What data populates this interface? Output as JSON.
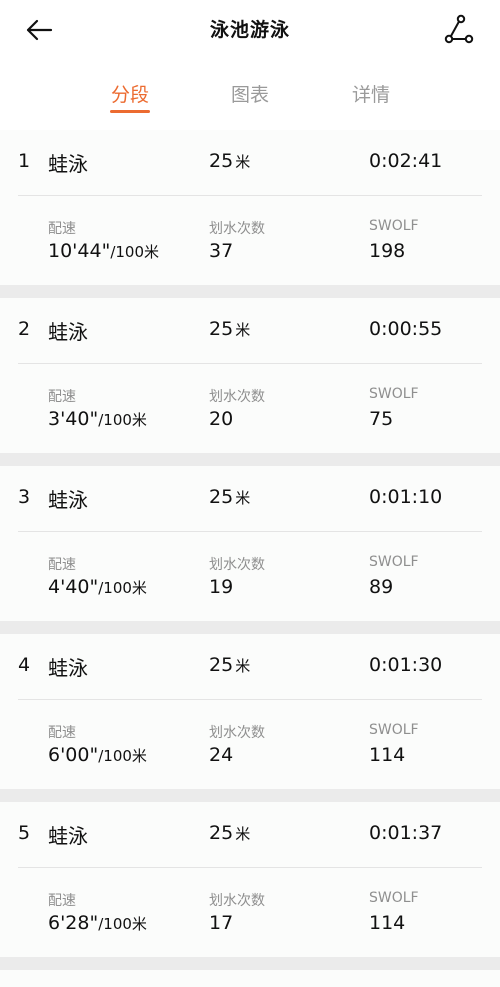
{
  "header": {
    "title": "泳池游泳",
    "back_icon": "arrow-left-icon",
    "route_icon": "route-icon"
  },
  "tabs": [
    {
      "label": "分段",
      "active": true
    },
    {
      "label": "图表",
      "active": false
    },
    {
      "label": "详情",
      "active": false
    }
  ],
  "accent_color": "#ec6b30",
  "labels": {
    "pace": "配速",
    "strokes": "划水次数",
    "swolf": "SWOLF",
    "distance_unit": "米",
    "pace_unit": "/100米"
  },
  "laps": [
    {
      "index": "1",
      "stroke": "蛙泳",
      "distance": "25",
      "time": "0:02:41",
      "pace": "10'44\"",
      "strokes": "37",
      "swolf": "198"
    },
    {
      "index": "2",
      "stroke": "蛙泳",
      "distance": "25",
      "time": "0:00:55",
      "pace": "3'40\"",
      "strokes": "20",
      "swolf": "75"
    },
    {
      "index": "3",
      "stroke": "蛙泳",
      "distance": "25",
      "time": "0:01:10",
      "pace": "4'40\"",
      "strokes": "19",
      "swolf": "89"
    },
    {
      "index": "4",
      "stroke": "蛙泳",
      "distance": "25",
      "time": "0:01:30",
      "pace": "6'00\"",
      "strokes": "24",
      "swolf": "114"
    },
    {
      "index": "5",
      "stroke": "蛙泳",
      "distance": "25",
      "time": "0:01:37",
      "pace": "6'28\"",
      "strokes": "17",
      "swolf": "114"
    }
  ]
}
